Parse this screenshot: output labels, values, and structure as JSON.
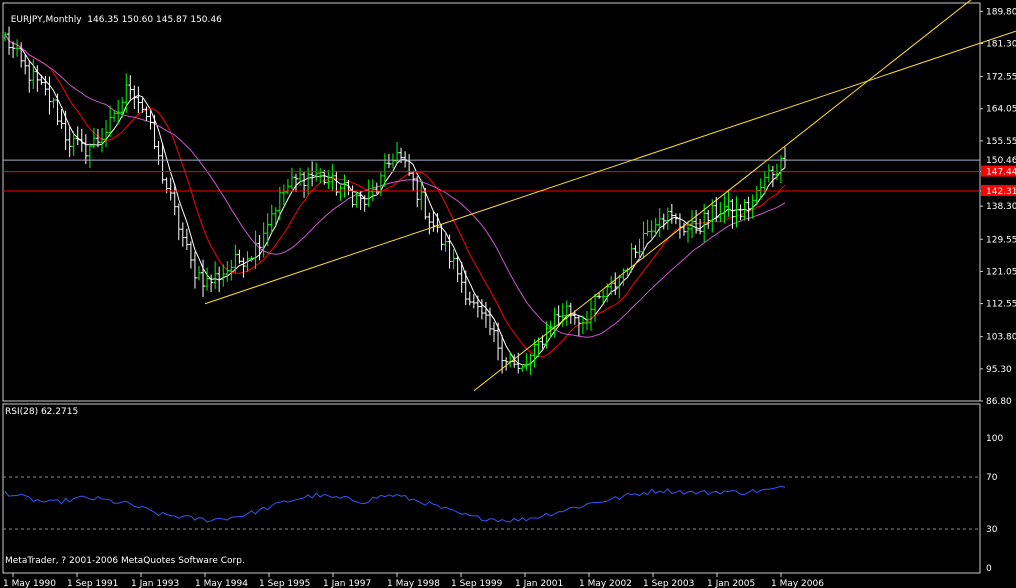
{
  "header": {
    "title": "EURJPY,Monthly",
    "ohlc": "146.35 150.60 145.87 150.46"
  },
  "footer": {
    "copyright": "MetaTrader, ? 2001-2006 MetaQuotes Software Corp."
  },
  "colors": {
    "background": "#000000",
    "bull_bar": "#00ff00",
    "bear_bar": "#ffffff",
    "fast_ma": "#ffffff",
    "mid_ma": "#ff0000",
    "slow_ma": "#cc55cc",
    "trendline": "#ffdd33",
    "hline": "#ff0000",
    "last_price_line": "#aaaacc",
    "rsi_line": "#3355ff",
    "axis": "#cccccc",
    "level_line": "#888888"
  },
  "chart_data": [
    {
      "type": "line",
      "subtype": "price-bars",
      "title": "EURJPY,Monthly",
      "yticks": [
        "189.80",
        "181.30",
        "172.55",
        "164.05",
        "155.55",
        "147.44",
        "142.31",
        "138.30",
        "129.55",
        "121.05",
        "112.55",
        "103.80",
        "95.30",
        "86.80"
      ],
      "ylim": [
        86.8,
        192
      ],
      "x": [
        "1 May 1990",
        "1 Sep 1991",
        "1 Jan 1993",
        "1 May 1994",
        "1 Sep 1995",
        "1 Jan 1997",
        "1 May 1998",
        "1 Sep 1999",
        "1 Jan 2001",
        "1 May 2002",
        "1 Sep 2003",
        "1 Jan 2005",
        "1 May 2006"
      ],
      "series": [
        {
          "values": [
            183,
            176,
            171,
            166,
            156,
            153,
            156,
            161,
            171,
            163,
            148,
            135,
            122,
            118,
            121,
            124,
            127,
            136,
            143,
            146,
            147,
            144,
            142,
            139,
            144,
            153,
            146,
            137,
            129,
            121,
            112,
            106,
            99,
            94,
            100,
            108,
            111,
            108,
            113,
            117,
            124,
            131,
            137,
            134,
            132,
            135,
            138,
            136,
            140,
            147,
            150.46
          ]
        }
      ],
      "price_labels": {
        "last": "150.46",
        "h1": "147.44",
        "h2": "142.31"
      },
      "trendlines": [
        {
          "from": [
            "1 May 1994",
            112.5
          ],
          "to": [
            "1 Jan 2005",
            158
          ]
        },
        {
          "from": [
            "1 Jan 2000",
            89.5
          ],
          "to": [
            "1 Sep 2006",
            150
          ]
        }
      ]
    },
    {
      "type": "line",
      "title": "RSI(28) 62.2715",
      "name": "RSI(28)",
      "last_value": "62.2715",
      "yticks": [
        "100",
        "70",
        "30",
        "0"
      ],
      "levels": [
        70,
        30
      ],
      "ylim": [
        0,
        100
      ],
      "values": [
        58,
        55,
        52,
        50,
        52,
        54,
        53,
        51,
        49,
        45,
        41,
        40,
        38,
        37,
        38,
        40,
        43,
        47,
        51,
        54,
        56,
        54,
        53,
        51,
        55,
        56,
        53,
        50,
        46,
        42,
        39,
        38,
        37,
        37,
        39,
        42,
        45,
        48,
        51,
        53,
        56,
        58,
        60,
        59,
        58,
        58,
        59,
        58,
        59,
        60,
        62
      ]
    }
  ]
}
